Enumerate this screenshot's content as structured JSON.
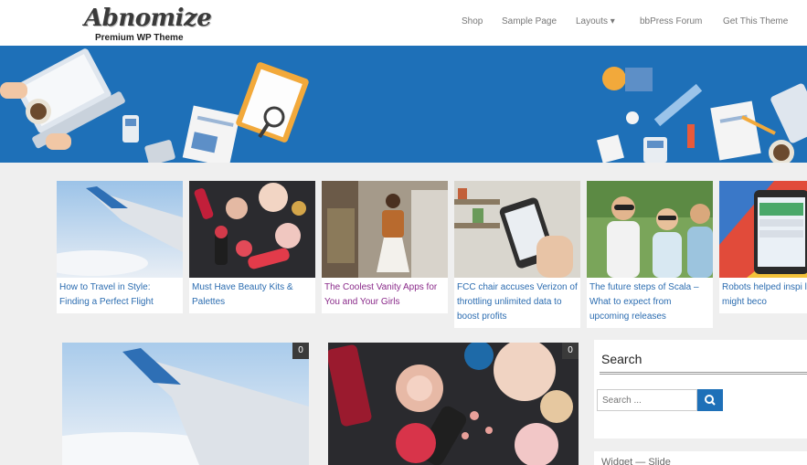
{
  "site": {
    "logo_title": "Abnomize",
    "logo_subtitle": "Premium WP Theme"
  },
  "nav": [
    {
      "label": "Shop"
    },
    {
      "label": "Sample Page"
    },
    {
      "label": "Layouts ▾"
    },
    {
      "label": "bbPress Forum"
    },
    {
      "label": "Get This Theme"
    }
  ],
  "featured": [
    {
      "caption": "How to Travel in Style: Finding a Perfect Flight",
      "image": "airplane-wing"
    },
    {
      "caption": "Must Have Beauty Kits & Palettes",
      "image": "makeup"
    },
    {
      "caption": "The Coolest Vanity Apps for You and Your Girls",
      "image": "fashion-woman"
    },
    {
      "caption": "FCC chair accuses Verizon of throttling unlimited data to boost profits",
      "image": "smartphone-hand"
    },
    {
      "caption": "The future steps of Scala – What to expect from upcoming releases",
      "image": "group-friends"
    },
    {
      "caption": "Robots helped inspi learning might beco",
      "image": "android-tablet"
    }
  ],
  "posts": [
    {
      "comments": "0",
      "image": "airplane-wing"
    },
    {
      "comments": "0",
      "image": "makeup"
    }
  ],
  "sidebar": {
    "search_title": "Search",
    "search_placeholder": "Search ...",
    "search_icon": "search-icon",
    "next_widget_title": "Widget — Slide"
  },
  "colors": {
    "accent": "#1e70b8",
    "link": "#2b6cb0",
    "visited_link": "#8a2a8a",
    "badge": "#3a3a3a"
  }
}
